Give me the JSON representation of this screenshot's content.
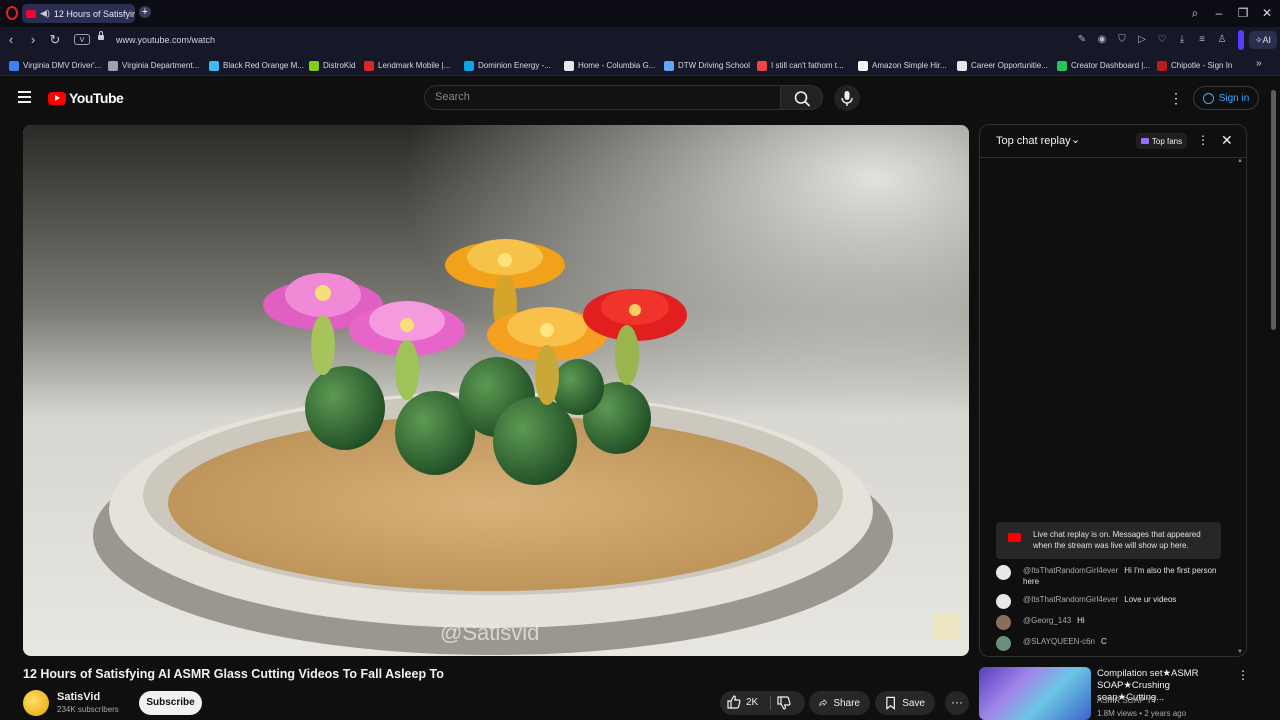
{
  "browser": {
    "tab_title": "12 Hours of Satisfying",
    "url": "www.youtube.com/watch",
    "v_badge": "V",
    "ai_label": "AI",
    "bookmarks": [
      {
        "label": "Virginia DMV Driver'...",
        "color": "#3b82f6"
      },
      {
        "label": "Virginia Department...",
        "color": "#9ca3af"
      },
      {
        "label": "Black Red Orange M...",
        "color": "#38bdf8"
      },
      {
        "label": "DistroKid",
        "color": "#84cc16"
      },
      {
        "label": "Lendmark Mobile |...",
        "color": "#dc2626"
      },
      {
        "label": "Dominion Energy -...",
        "color": "#0ea5e9"
      },
      {
        "label": "Home - Columbia G...",
        "color": "#e5e7eb"
      },
      {
        "label": "DTW Driving School",
        "color": "#60a5fa"
      },
      {
        "label": "I still can't fathom t...",
        "color": "#ef4444"
      },
      {
        "label": "Amazon Simple Hir...",
        "color": "#f5f5f5"
      },
      {
        "label": "Career Opportunitie...",
        "color": "#e5e7eb"
      },
      {
        "label": "Creator Dashboard |...",
        "color": "#22c55e"
      },
      {
        "label": "Chipotle - Sign In",
        "color": "#b91c1c"
      }
    ]
  },
  "youtube": {
    "logo_text": "YouTube",
    "search_placeholder": "Search",
    "signin_label": "Sign in"
  },
  "video": {
    "watermark": "@Satisvid",
    "title": "12 Hours of Satisfying AI ASMR Glass Cutting Videos To Fall Asleep To",
    "channel_name": "SatisVid",
    "subscribers": "234K subscribers",
    "subscribe_label": "Subscribe",
    "likes": "2K",
    "share_label": "Share",
    "save_label": "Save"
  },
  "chat": {
    "title": "Top chat replay",
    "top_fans_label": "Top fans",
    "notice": "Live chat replay is on. Messages that appeared when the stream was live will show up here.",
    "messages": [
      {
        "author": "@ItsThatRandomGirl4ever",
        "text": "Hi I'm also the first person here",
        "avatar_color": "#e8e8e8"
      },
      {
        "author": "@ItsThatRandomGirl4ever",
        "text": "Love ur videos",
        "avatar_color": "#e8e8e8"
      },
      {
        "author": "@Georg_143",
        "text": "Hi",
        "avatar_color": "#8a6d5a"
      },
      {
        "author": "@SLAYQUEEN-c6n",
        "text": "C",
        "avatar_color": "#6b8f7a"
      }
    ]
  },
  "recommendation": {
    "title": "Compilation set★ASMR SOAP★Crushing soap★Cutting...",
    "channel": "ASMR SOAP YT",
    "meta": "1.8M views • 2 years ago"
  }
}
